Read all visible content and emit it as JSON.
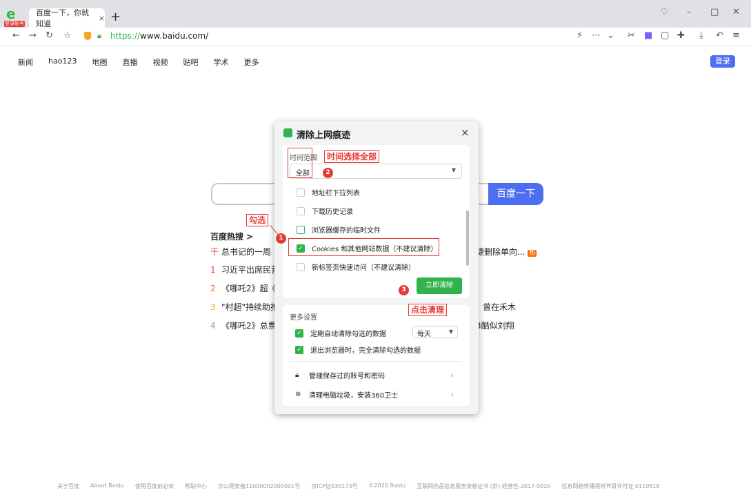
{
  "browser": {
    "badge": "登录账号",
    "tab_title": "百度一下，你就知道",
    "url_proto": "https://",
    "url_host": "www.baidu.com/"
  },
  "page": {
    "nav": [
      "新闻",
      "hao123",
      "地图",
      "直播",
      "视频",
      "贴吧",
      "学术",
      "更多"
    ],
    "login": "登录",
    "search_button": "百度一下",
    "hot_title": "百度热搜 >",
    "hot": [
      {
        "num": "千",
        "left": "总书记的一周",
        "right": "捷删除单向..."
      },
      {
        "num": "1",
        "left": "习近平出席民营",
        "right": ""
      },
      {
        "num": "2",
        "left": "《哪吒2》超《",
        "right": ""
      },
      {
        "num": "3",
        "left": "\"村超\"持续助推",
        "right": "曾在禾木"
      },
      {
        "num": "4",
        "left": "《哪吒2》总票",
        "right": "3酷似刘翔"
      }
    ],
    "hot_badge": "热",
    "footer": [
      "关于百度",
      "About Baidu",
      "使用百度前必读",
      "帮助中心",
      "京公网安备11000002000001号",
      "京ICP证030173号",
      "©2026 Baidu",
      "互联网药品信息服务资格证书 (京)-经营性-2017-0020",
      "信息网络传播视听节目许可证 0110516"
    ]
  },
  "dialog": {
    "title": "清除上网痕迹",
    "close": "×",
    "range_label": "时间范围",
    "range_value": "全部",
    "options": [
      {
        "label": "地址栏下拉列表",
        "checked": false
      },
      {
        "label": "下载历史记录",
        "checked": false
      },
      {
        "label": "浏览器缓存的临时文件",
        "checked": false
      },
      {
        "label": "Cookies 和其他网站数据（不建议清除）",
        "checked": true
      },
      {
        "label": "新标签页快速访问（不建议清除）",
        "checked": false
      }
    ],
    "clear_button": "立即清除",
    "more_title": "更多设置",
    "auto_clear": "定期自动清除勾选的数据",
    "freq_value": "每天",
    "exit_clear": "退出浏览器时，完全清除勾选的数据",
    "manage_accounts": "管理保存过的账号和密码",
    "install_360": "清理电脑垃圾，安装360卫士"
  },
  "annotations": {
    "select_all_time": "时间选择全部",
    "check": "勾选",
    "click_clear": "点击清理",
    "n1": "1",
    "n2": "2",
    "n3": "3"
  },
  "colors": {
    "accent_green": "#2fb34a",
    "baidu_blue": "#4e6ef2",
    "annotation_red": "#e53935"
  }
}
